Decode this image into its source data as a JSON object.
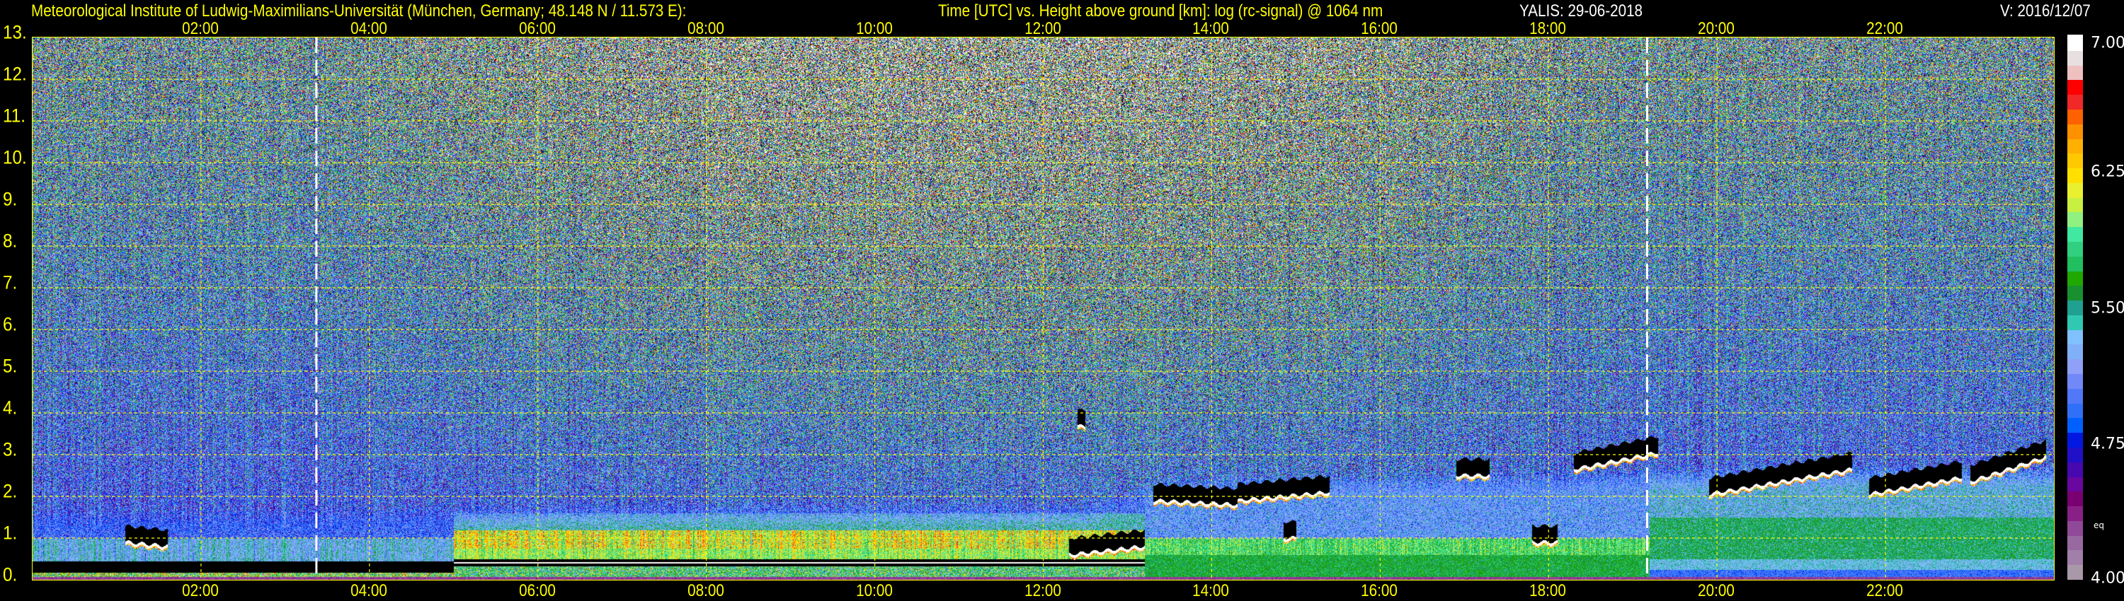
{
  "header": {
    "institute": "Meteorological Institute of Ludwig-Maximilians-Universität (München, Germany; 48.148 N / 11.573 E):",
    "description": "Time [UTC] vs. Height above ground [km]: log (rc-signal) @ 1064 nm",
    "instrument_date": "YALIS: 29-06-2018",
    "version": "V: 2016/12/07"
  },
  "chart_data": {
    "type": "heatmap",
    "title": "Time [UTC] vs. Height above ground [km]: log (rc-signal) @ 1064 nm",
    "xlabel": "Time [UTC]",
    "ylabel": "Height above ground [km]",
    "xlim_hours": [
      0,
      24
    ],
    "ylim_km": [
      0,
      13
    ],
    "x_ticks": [
      "02:00",
      "04:00",
      "06:00",
      "08:00",
      "10:00",
      "12:00",
      "14:00",
      "16:00",
      "18:00",
      "20:00",
      "22:00"
    ],
    "x_tick_hours": [
      2,
      4,
      6,
      8,
      10,
      12,
      14,
      16,
      18,
      20,
      22
    ],
    "y_ticks": [
      "0.",
      "1.",
      "2.",
      "3.",
      "4.",
      "5.",
      "6.",
      "7.",
      "8.",
      "9.",
      "10.",
      "11.",
      "12.",
      "13."
    ],
    "y_tick_values": [
      0,
      1,
      2,
      3,
      4,
      5,
      6,
      7,
      8,
      9,
      10,
      11,
      12,
      13
    ],
    "grid": true,
    "marker_lines_hours": [
      3.37,
      19.17
    ],
    "colorbar": {
      "range": [
        4.0,
        7.0
      ],
      "ticks": [
        "7.00",
        "6.25",
        "5.50",
        "4.75",
        "4.00"
      ],
      "tick_values": [
        7.0,
        6.25,
        5.5,
        4.75,
        4.0
      ],
      "note": "eq",
      "colors_low_to_high": [
        "#a898a8",
        "#a080a8",
        "#9868a0",
        "#904898",
        "#882088",
        "#780070",
        "#6808a0",
        "#4808b0",
        "#2010c8",
        "#0018e0",
        "#0060ff",
        "#3070f8",
        "#5078f8",
        "#7088f8",
        "#90a0f8",
        "#80b0f8",
        "#80c0ff",
        "#30c8b0",
        "#20a090",
        "#189030",
        "#20a800",
        "#20c060",
        "#30d080",
        "#40e8a0",
        "#90f080",
        "#c8f040",
        "#e8f030",
        "#ffe000",
        "#ffc800",
        "#ffb000",
        "#ff9000",
        "#ff6000",
        "#f02828",
        "#ff0000",
        "#efc0c0",
        "#e8dfe0",
        "#ffffff"
      ]
    },
    "boundary_layer_top_km": {
      "hours": [
        0,
        3,
        5,
        7,
        9,
        11,
        12.5,
        13.5,
        15,
        17,
        19,
        21,
        23,
        24
      ],
      "values": [
        1.1,
        1.1,
        1.2,
        1.3,
        1.3,
        1.3,
        1.3,
        1.9,
        2.0,
        2.0,
        2.1,
        2.2,
        2.2,
        2.2
      ]
    },
    "cloud_layers": [
      {
        "start_h": 1.1,
        "end_h": 1.6,
        "base_km": [
          0.85,
          0.75
        ]
      },
      {
        "start_h": 12.3,
        "end_h": 13.2,
        "base_km": [
          0.55,
          0.75
        ]
      },
      {
        "start_h": 12.4,
        "end_h": 12.5,
        "base_km": [
          3.65,
          3.6
        ]
      },
      {
        "start_h": 13.3,
        "end_h": 14.3,
        "base_km": [
          1.85,
          1.75
        ]
      },
      {
        "start_h": 14.3,
        "end_h": 15.4,
        "base_km": [
          1.85,
          2.05
        ]
      },
      {
        "start_h": 14.85,
        "end_h": 15.0,
        "base_km": [
          0.95,
          0.95
        ]
      },
      {
        "start_h": 16.9,
        "end_h": 17.3,
        "base_km": [
          2.45,
          2.45
        ]
      },
      {
        "start_h": 17.8,
        "end_h": 18.1,
        "base_km": [
          0.85,
          0.85
        ]
      },
      {
        "start_h": 18.3,
        "end_h": 19.3,
        "base_km": [
          2.6,
          3.0
        ]
      },
      {
        "start_h": 19.9,
        "end_h": 21.6,
        "base_km": [
          2.0,
          2.6
        ]
      },
      {
        "start_h": 21.8,
        "end_h": 22.9,
        "base_km": [
          2.0,
          2.4
        ]
      },
      {
        "start_h": 23.0,
        "end_h": 23.9,
        "base_km": [
          2.3,
          2.9
        ]
      }
    ]
  }
}
